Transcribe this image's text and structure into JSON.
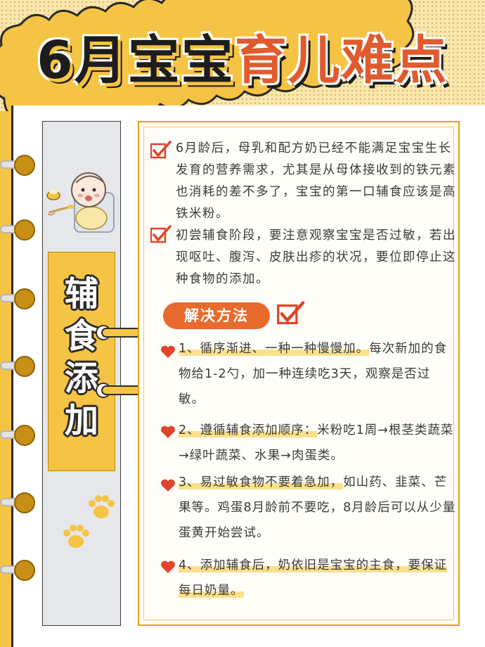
{
  "header": {
    "title_part1": "6月宝宝",
    "title_part2": "育儿难点"
  },
  "side": {
    "label_chars": [
      "辅",
      "食",
      "添",
      "加"
    ]
  },
  "intro": {
    "paragraph1": "6月龄后，母乳和配方奶已经不能满足宝宝生长发育的营养需求，尤其是从母体接收到的铁元素也消耗的差不多了，宝宝的第一口辅食应该是高铁米粉。",
    "paragraph2": "初尝辅食阶段，要注意观察宝宝是否过敏，若出现呕吐、腹泻、皮肤出疹的状况，要位即停止这种食物的添加。"
  },
  "solutions": {
    "heading": "解决方法",
    "items": [
      {
        "lead": "1、循序渐进、一种一种慢慢加。",
        "rest": "每次新加的食物给1-2勺，加一种连续吃3天，观察是否过敏。"
      },
      {
        "lead": "2、遵循辅食添加顺序：",
        "rest": "米粉吃1周→根茎类蔬菜→绿叶蔬菜、水果→肉蛋类。"
      },
      {
        "lead": "3、易过敏食物不要着急加，",
        "rest": "如山药、韭菜、芒果等。鸡蛋8月龄前不要吃，8月龄后可以从少量蛋黄开始尝试。"
      },
      {
        "lead": "4、添加辅食后，奶依旧是宝宝的主食，要保证每日奶量。",
        "rest": ""
      }
    ]
  },
  "colors": {
    "background_yellow": "#f6c444",
    "accent_orange": "#e86a2c",
    "title_red": "#e15a2e",
    "heart_red": "#e0442a"
  }
}
